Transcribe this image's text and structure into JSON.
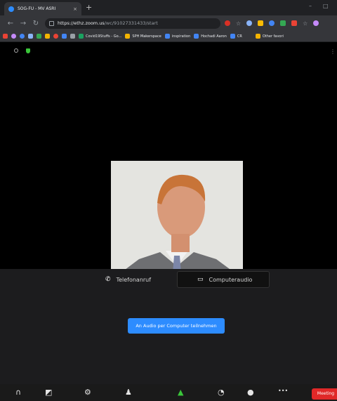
{
  "browser": {
    "tab_title": "SOG-FU - MV ASRI",
    "tab_close": "×",
    "new_tab": "+",
    "url_host": "https://ethz.zoom.us",
    "url_path": "/wc/91027331433/start",
    "window_min": "–",
    "window_max": "□"
  },
  "bookmarks": [
    {
      "label": "Covid19Stuffs - Go...",
      "color": "#1aa260"
    },
    {
      "label": "SPH Makerspace",
      "color": "#f4b400"
    },
    {
      "label": "inspiration",
      "color": "#4285f4"
    },
    {
      "label": "Hochadi Aaron",
      "color": "#4285f4"
    },
    {
      "label": "CR",
      "color": "#4285f4"
    }
  ],
  "bookmarks_more": "Other favori",
  "audio": {
    "phone_label": "Telefonanruf",
    "computer_label": "Computeraudio",
    "join_button": "An Audio per Computer teilnehmen"
  },
  "toolbar": {
    "end_label": "Meeting beenden",
    "more": "•••"
  }
}
